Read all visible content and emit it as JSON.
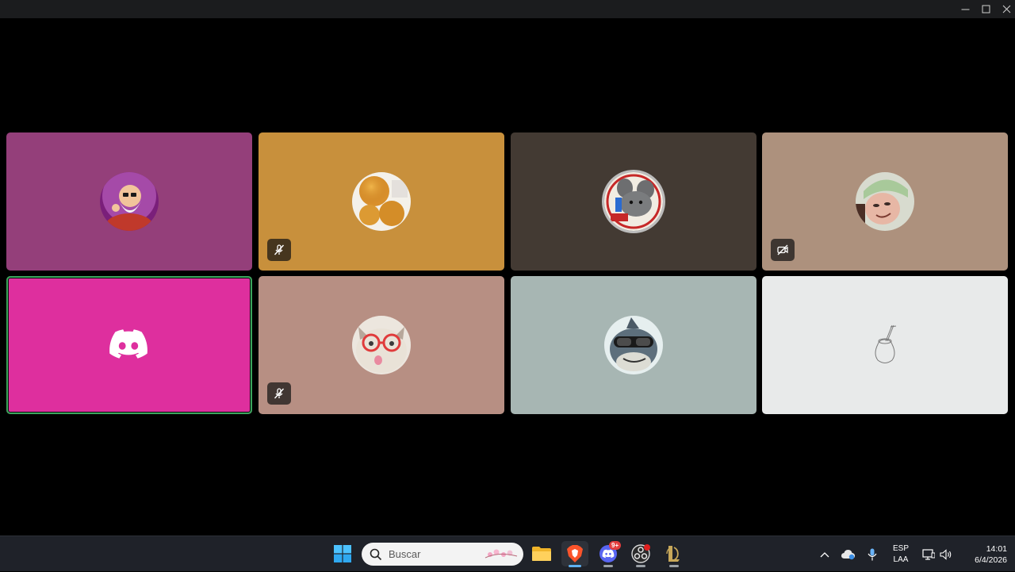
{
  "window": {
    "controls": [
      "minimize",
      "maximize",
      "close"
    ]
  },
  "tiles": [
    {
      "name": "roshi",
      "bg": "#943f7a",
      "status": null
    },
    {
      "name": "buñuelos",
      "bg": "#c8903c",
      "status": "mic-muted"
    },
    {
      "name": "mouse",
      "bg": "#433a33",
      "status": null
    },
    {
      "name": "selfie",
      "bg": "#ad917d",
      "status": "camera-off"
    },
    {
      "name": "discord-default",
      "bg": "#de2f9e",
      "status": null,
      "speaking": true
    },
    {
      "name": "cat",
      "bg": "#b78f83",
      "status": "mic-muted"
    },
    {
      "name": "shark",
      "bg": "#a7b6b3",
      "status": null
    },
    {
      "name": "mate",
      "bg": "#e8eaea",
      "status": null
    }
  ],
  "taskbar": {
    "search_placeholder": "Buscar",
    "discord_badge": "9+",
    "apps": [
      "start-icon",
      "file-explorer-icon",
      "brave-icon",
      "discord-icon",
      "obs-icon",
      "league-icon"
    ]
  },
  "tray": {
    "lang_line1": "ESP",
    "lang_line2": "LAA",
    "time": "14:01",
    "date": "6/4/2026"
  }
}
